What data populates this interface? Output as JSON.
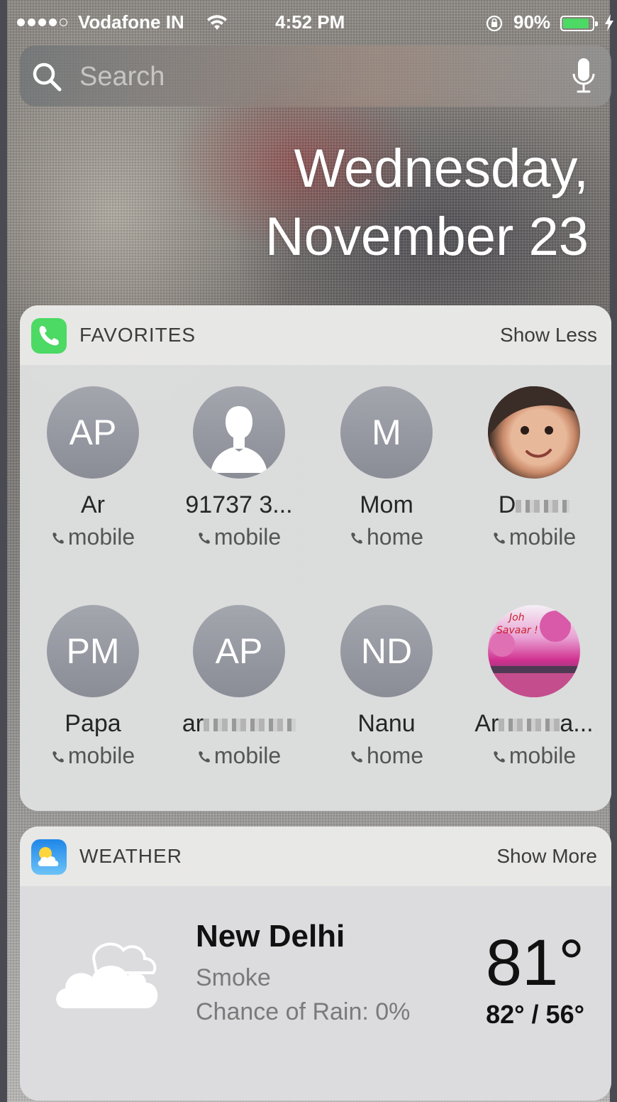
{
  "status_bar": {
    "carrier": "Vodafone IN",
    "time": "4:52 PM",
    "battery_percent": "90%",
    "battery_level": 0.9,
    "signal_bars_filled": 4,
    "signal_bars_total": 5
  },
  "search": {
    "placeholder": "Search"
  },
  "date": {
    "line1": "Wednesday,",
    "line2": "November 23"
  },
  "favorites": {
    "title": "FAVORITES",
    "action": "Show Less",
    "contacts": [
      {
        "initials": "AP",
        "name": "Ar",
        "type": "mobile"
      },
      {
        "initials": "",
        "name": "91737 3...",
        "type": "mobile"
      },
      {
        "initials": "M",
        "name": "Mom",
        "type": "home"
      },
      {
        "initials": "",
        "name": "D",
        "type": "mobile"
      },
      {
        "initials": "PM",
        "name": "Papa",
        "type": "mobile"
      },
      {
        "initials": "AP",
        "name": "ar",
        "type": "mobile"
      },
      {
        "initials": "ND",
        "name": "Nanu",
        "type": "home"
      },
      {
        "initials": "",
        "name": "Ar",
        "name_suffix": "a...",
        "type": "mobile"
      }
    ]
  },
  "weather": {
    "title": "WEATHER",
    "action": "Show More",
    "city": "New Delhi",
    "condition": "Smoke",
    "rain_chance": "Chance of Rain: 0%",
    "temperature": "81°",
    "high_low": "82° / 56°"
  },
  "colors": {
    "battery_fill": "#4cd964",
    "phone_app": "#4cd964",
    "weather_app": "#2f9bf0"
  }
}
